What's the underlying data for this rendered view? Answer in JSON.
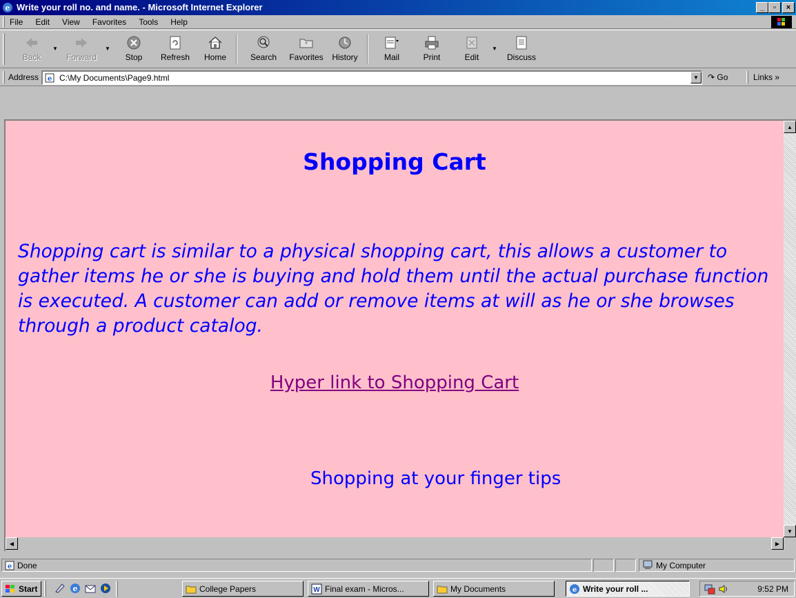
{
  "window": {
    "title": "Write your roll no. and name. - Microsoft Internet Explorer",
    "controls": {
      "minimize": "_",
      "maximize": "▫",
      "close": "×"
    }
  },
  "menubar": {
    "items": [
      "File",
      "Edit",
      "View",
      "Favorites",
      "Tools",
      "Help"
    ]
  },
  "toolbar": {
    "back": "Back",
    "forward": "Forward",
    "stop": "Stop",
    "refresh": "Refresh",
    "home": "Home",
    "search": "Search",
    "favorites": "Favorites",
    "history": "History",
    "mail": "Mail",
    "print": "Print",
    "edit": "Edit",
    "discuss": "Discuss"
  },
  "address": {
    "label": "Address",
    "value": "C:\\My Documents\\Page9.html",
    "go": "Go",
    "links": "Links »"
  },
  "page": {
    "heading": "Shopping Cart",
    "paragraph": "Shopping cart is similar to a physical shopping cart, this allows a customer to gather items he or she is buying and hold them until the actual purchase function is executed. A customer can add or remove items at will as he or she browses through a product catalog.",
    "link": "Hyper link to Shopping Cart",
    "tagline": "Shopping at your finger tips",
    "background": "#ffc0cb",
    "text_color": "#0000ff",
    "link_color": "#800080"
  },
  "status": {
    "text": "Done",
    "zone": "My Computer"
  },
  "taskbar": {
    "start": "Start",
    "tasks": [
      {
        "label": "College Papers",
        "icon": "folder-icon"
      },
      {
        "label": "Final exam - Micros...",
        "icon": "word-icon"
      },
      {
        "label": "My Documents",
        "icon": "folder-icon"
      },
      {
        "label": "Write your roll ...",
        "icon": "ie-icon",
        "active": true
      }
    ],
    "clock": "9:52 PM"
  }
}
